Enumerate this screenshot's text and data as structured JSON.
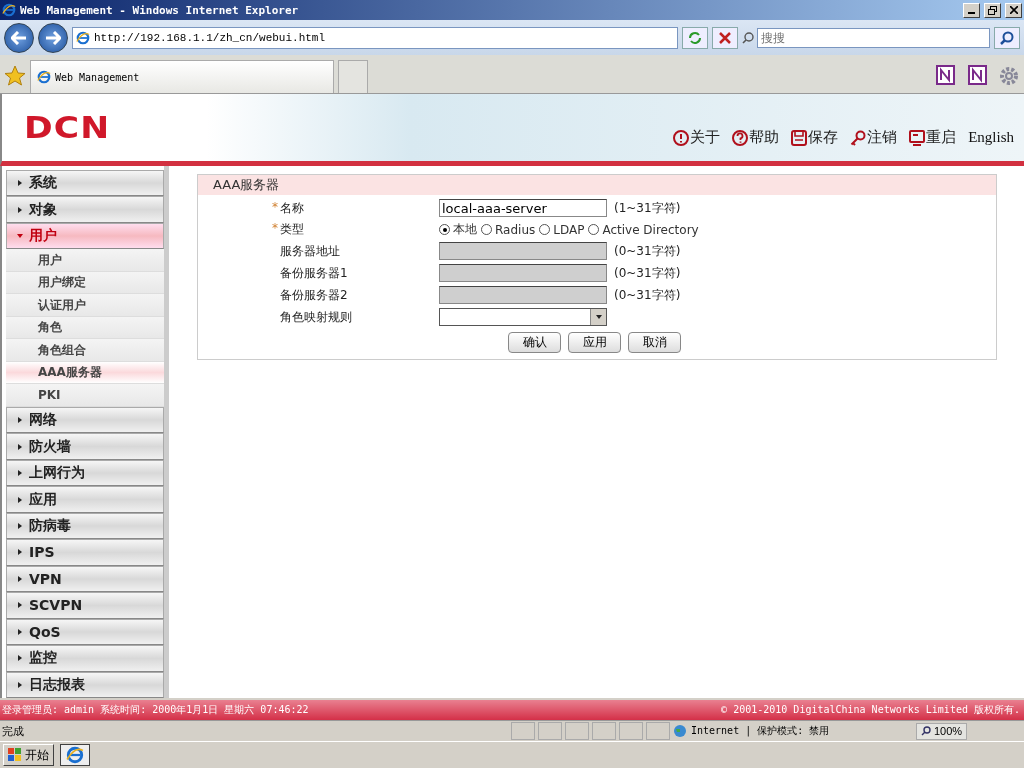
{
  "window": {
    "title": "Web Management - Windows Internet Explorer"
  },
  "browser": {
    "address": "http://192.168.1.1/zh_cn/webui.html",
    "search_placeholder": "搜搜",
    "tab": "Web Management"
  },
  "header": {
    "logo": "DCN",
    "links": [
      {
        "label": "关于",
        "kind": "about"
      },
      {
        "label": "帮助",
        "kind": "help"
      },
      {
        "label": "保存",
        "kind": "save"
      },
      {
        "label": "注销",
        "kind": "logout"
      },
      {
        "label": "重启",
        "kind": "reboot"
      }
    ],
    "language": "English"
  },
  "sidebar": {
    "items": [
      {
        "label": "系统",
        "expanded": false
      },
      {
        "label": "对象",
        "expanded": false
      },
      {
        "label": "用户",
        "expanded": true,
        "children": [
          {
            "label": "用户",
            "selected": false
          },
          {
            "label": "用户绑定",
            "selected": false
          },
          {
            "label": "认证用户",
            "selected": false
          },
          {
            "label": "角色",
            "selected": false
          },
          {
            "label": "角色组合",
            "selected": false
          },
          {
            "label": "AAA服务器",
            "selected": true
          },
          {
            "label": "PKI",
            "selected": false
          }
        ]
      },
      {
        "label": "网络",
        "expanded": false
      },
      {
        "label": "防火墙",
        "expanded": false
      },
      {
        "label": "上网行为",
        "expanded": false
      },
      {
        "label": "应用",
        "expanded": false
      },
      {
        "label": "防病毒",
        "expanded": false
      },
      {
        "label": "IPS",
        "expanded": false
      },
      {
        "label": "VPN",
        "expanded": false
      },
      {
        "label": "SCVPN",
        "expanded": false
      },
      {
        "label": "QoS",
        "expanded": false
      },
      {
        "label": "监控",
        "expanded": false
      },
      {
        "label": "日志报表",
        "expanded": false
      }
    ]
  },
  "form": {
    "title": "AAA服务器",
    "fields": [
      {
        "kind": "text",
        "label": "名称",
        "required_mark": "*",
        "value": "local-aaa-server",
        "disabled": false,
        "hint": "(1~31字符)"
      },
      {
        "kind": "radio",
        "label": "类型",
        "required_mark": "*",
        "options": [
          {
            "label": "本地",
            "selected": true
          },
          {
            "label": "Radius",
            "selected": false
          },
          {
            "label": "LDAP",
            "selected": false
          },
          {
            "label": "Active Directory",
            "selected": false
          }
        ]
      },
      {
        "kind": "text",
        "label": "服务器地址",
        "disabled": true,
        "hint": "(0~31字符)"
      },
      {
        "kind": "text",
        "label": "备份服务器1",
        "disabled": true,
        "hint": "(0~31字符)"
      },
      {
        "kind": "text",
        "label": "备份服务器2",
        "disabled": true,
        "hint": "(0~31字符)"
      },
      {
        "kind": "select",
        "label": "角色映射规则"
      }
    ],
    "buttons": [
      "确认",
      "应用",
      "取消"
    ]
  },
  "footer": {
    "login": "登录管理员: admin 系统时间: 2000年1月1日 星期六 07:46:22",
    "copyright": "© 2001-2010 DigitalChina Networks Limited 版权所有."
  },
  "status_bar": {
    "status": "完成",
    "zone": "Internet | 保护模式: 禁用",
    "zoom": "100%"
  },
  "taskbar": {
    "start": "开始"
  }
}
